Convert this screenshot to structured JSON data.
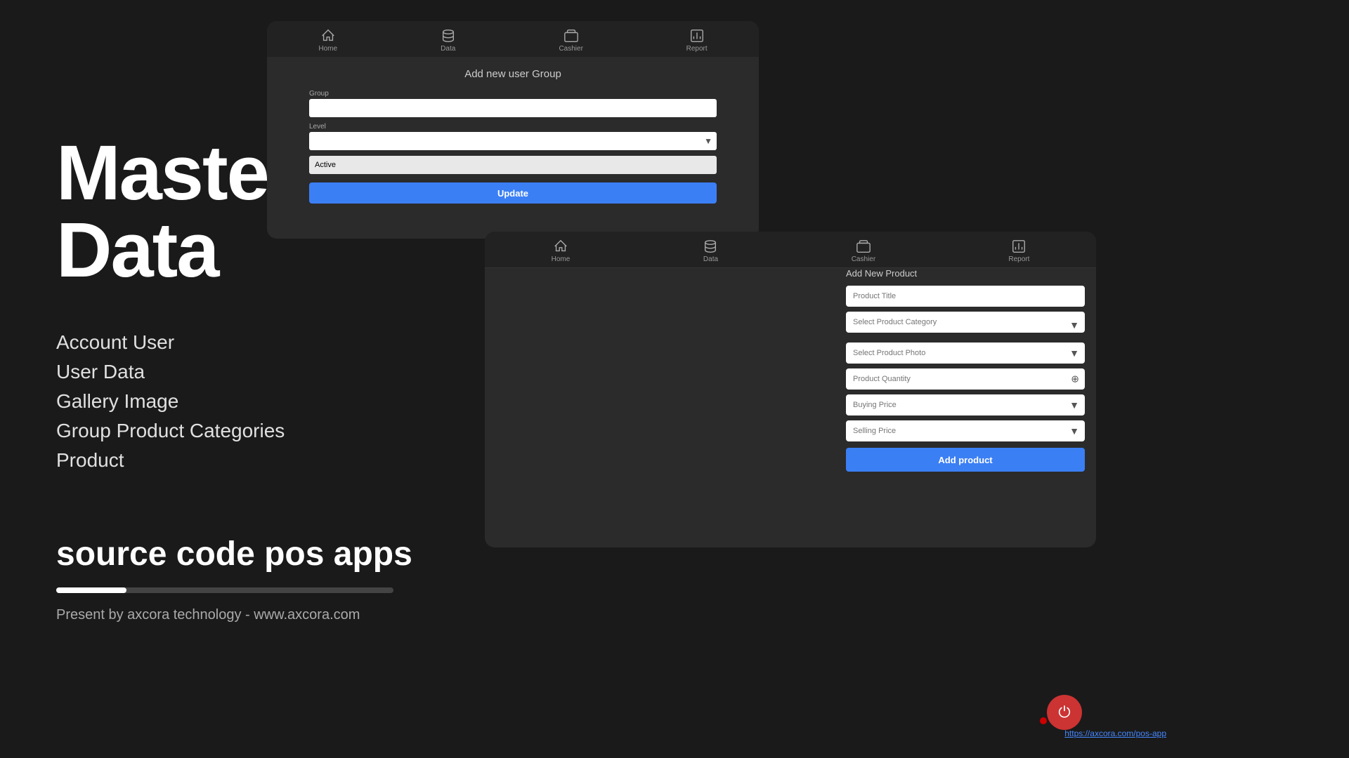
{
  "page": {
    "background_color": "#1a1a1a"
  },
  "left": {
    "title_line1": "Master",
    "title_line2": "Data",
    "menu_items": [
      {
        "label": "Account User"
      },
      {
        "label": "User Data"
      },
      {
        "label": "Gallery Image"
      },
      {
        "label": "Group Product Categories"
      },
      {
        "label": "Product"
      }
    ],
    "source_code_text": "source code pos apps",
    "present_text": "Present by axcora technology - www.axcora.com"
  },
  "top_app": {
    "nav_items": [
      {
        "label": "Home",
        "icon": "home"
      },
      {
        "label": "Data",
        "icon": "data"
      },
      {
        "label": "Cashier",
        "icon": "cashier"
      },
      {
        "label": "Report",
        "icon": "report"
      }
    ],
    "form_title": "Add new user Group",
    "group_label": "Group",
    "level_label": "Level",
    "active_placeholder": "Active",
    "update_button": "Update"
  },
  "bottom_app": {
    "nav_items": [
      {
        "label": "Home",
        "icon": "home"
      },
      {
        "label": "Data",
        "icon": "data"
      },
      {
        "label": "Cashier",
        "icon": "cashier"
      },
      {
        "label": "Report",
        "icon": "report"
      }
    ],
    "form_title": "Add New Product",
    "fields": [
      {
        "placeholder": "Product Title",
        "type": "text"
      },
      {
        "placeholder": "Select Product Category",
        "type": "select"
      },
      {
        "placeholder": "Select Product Photo",
        "type": "select"
      },
      {
        "placeholder": "Product Quantity",
        "type": "number"
      },
      {
        "placeholder": "Buying Price",
        "type": "number"
      },
      {
        "placeholder": "Selling Price",
        "type": "number"
      }
    ],
    "add_button": "Add product"
  },
  "footer": {
    "link_text": "https://axcora.com/pos-app",
    "power_icon": "⏻"
  }
}
